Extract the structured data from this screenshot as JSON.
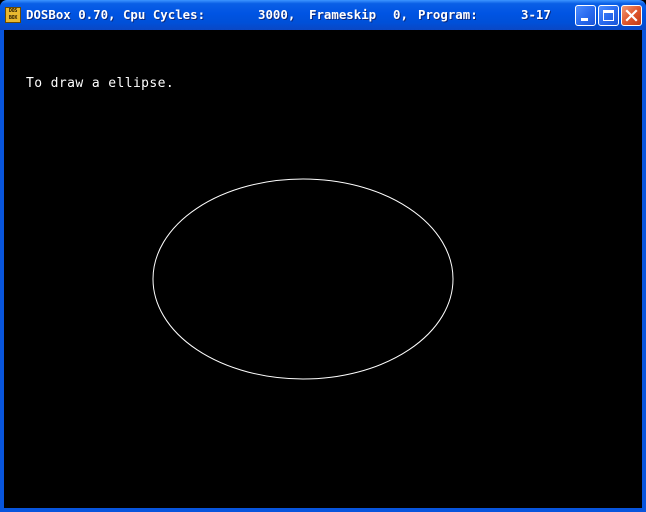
{
  "window": {
    "title_app": "DOSBox 0.70, Cpu Cycles:",
    "cycles_value": "3000,",
    "frameskip_label": "Frameskip",
    "frameskip_value": "0,",
    "program_label": "Program:",
    "program_value": "3-17",
    "icon_text_top": "DOS",
    "icon_text_bottom": "BOX"
  },
  "screen": {
    "message": "To draw a ellipse.",
    "shape": "ellipse"
  },
  "colors": {
    "titlebar": "#0054e3",
    "screen_background": "#000000",
    "foreground": "#ffffff"
  },
  "icons": {
    "app": "dosbox-icon",
    "minimize": "minimize-icon",
    "maximize": "maximize-icon",
    "close": "close-icon"
  }
}
